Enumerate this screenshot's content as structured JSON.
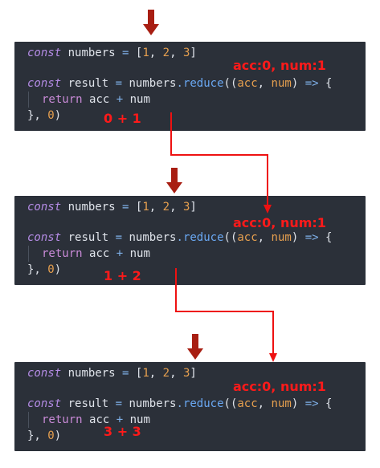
{
  "code": {
    "const_kw": "const",
    "numbers_var": "numbers",
    "equals": "=",
    "open_bracket": "[",
    "n1": "1",
    "comma": ",",
    "n2": "2",
    "n3": "3",
    "close_bracket": "]",
    "result_var": "result",
    "dot": ".",
    "reduce_fn": "reduce",
    "open_parens": "((",
    "acc_param": "acc",
    "num_param": "num",
    "close_paren": ")",
    "arrow": "=>",
    "open_brace": "{",
    "return_kw": "return",
    "plus": "+",
    "close_brace": "},",
    "zero": "0",
    "final_paren": ")"
  },
  "steps": [
    {
      "state_label": "acc:0, num:1",
      "expr_label": "0 + 1"
    },
    {
      "state_label": "acc:0, num:1",
      "expr_label": "1 + 2"
    },
    {
      "state_label": "acc:0, num:1",
      "expr_label": "3 + 3"
    }
  ],
  "colors": {
    "panel_bg": "#2b3039",
    "annotation": "#ff1a1a",
    "arrow_dark": "#a81e12",
    "keyword": "#b58ce6",
    "number": "#e7a04f",
    "function": "#6aa8f3"
  }
}
